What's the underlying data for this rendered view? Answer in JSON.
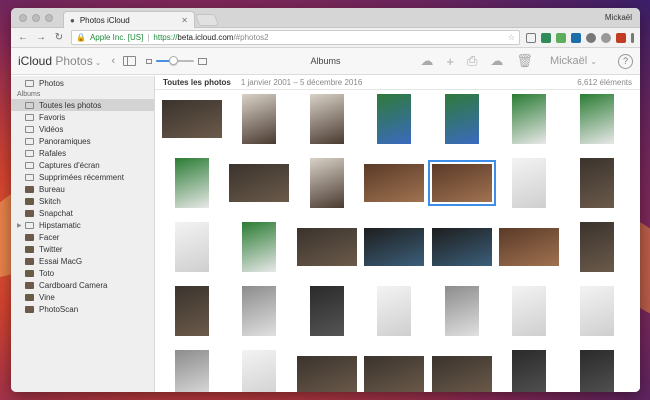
{
  "browser": {
    "tab_title": "Photos iCloud",
    "profile_name": "Mickaël",
    "security_label": "Apple Inc. [US]",
    "url_scheme": "https://",
    "url_host": "beta.icloud.com",
    "url_path": "/#photos2"
  },
  "app": {
    "brand": "iCloud",
    "app_name": "Photos",
    "view_title": "Albums",
    "account_name": "Mickaël",
    "zoom_level": 0.45
  },
  "sidebar": {
    "top_items": [
      {
        "label": "Photos",
        "icon": "photos-icon"
      }
    ],
    "section_label": "Albums",
    "album_items": [
      {
        "label": "Toutes les photos",
        "icon": "all-photos-icon",
        "selected": true
      },
      {
        "label": "Favoris",
        "icon": "heart-icon"
      },
      {
        "label": "Vidéos",
        "icon": "video-icon"
      },
      {
        "label": "Panoramiques",
        "icon": "panorama-icon"
      },
      {
        "label": "Rafales",
        "icon": "burst-icon"
      },
      {
        "label": "Captures d'écran",
        "icon": "screenshot-icon"
      },
      {
        "label": "Supprimées récemment",
        "icon": "trash-icon"
      },
      {
        "label": "Bureau",
        "icon": "album-thumb-icon"
      },
      {
        "label": "Skitch",
        "icon": "album-thumb-icon"
      },
      {
        "label": "Snapchat",
        "icon": "album-thumb-icon"
      },
      {
        "label": "Hipstamatic",
        "icon": "folder-icon",
        "disclosure": true
      },
      {
        "label": "Facer",
        "icon": "album-thumb-icon"
      },
      {
        "label": "Twitter",
        "icon": "album-thumb-icon"
      },
      {
        "label": "Essai MacG",
        "icon": "album-thumb-icon"
      },
      {
        "label": "Toto",
        "icon": "album-thumb-icon"
      },
      {
        "label": "Cardboard Camera",
        "icon": "album-thumb-icon"
      },
      {
        "label": "Vine",
        "icon": "album-thumb-icon"
      },
      {
        "label": "PhotoScan",
        "icon": "album-thumb-icon"
      }
    ]
  },
  "content": {
    "title": "Toutes les photos",
    "date_range": "1 janvier 2001 – 5 décembre 2016",
    "count": "6,612 éléments"
  },
  "photos": [
    {
      "orient": "landscape",
      "kind": "cat"
    },
    {
      "orient": "portrait",
      "kind": "selfie"
    },
    {
      "orient": "portrait",
      "kind": "selfie"
    },
    {
      "orient": "portrait",
      "kind": "game-green"
    },
    {
      "orient": "portrait",
      "kind": "game-green"
    },
    {
      "orient": "portrait",
      "kind": "solitaire"
    },
    {
      "orient": "portrait",
      "kind": "solitaire"
    },
    {
      "orient": "portrait",
      "kind": "solitaire"
    },
    {
      "orient": "landscape",
      "kind": "cat"
    },
    {
      "orient": "portrait",
      "kind": "selfie"
    },
    {
      "orient": "landscape",
      "kind": "cat-floor"
    },
    {
      "orient": "landscape",
      "kind": "cat-floor",
      "selected": true
    },
    {
      "orient": "portrait",
      "kind": "screen-white"
    },
    {
      "orient": "portrait",
      "kind": "cat"
    },
    {
      "orient": "portrait",
      "kind": "screen-white"
    },
    {
      "orient": "portrait",
      "kind": "solitaire"
    },
    {
      "orient": "landscape",
      "kind": "cat"
    },
    {
      "orient": "landscape",
      "kind": "dark-screen"
    },
    {
      "orient": "landscape",
      "kind": "dark-screen"
    },
    {
      "orient": "landscape",
      "kind": "cat-floor"
    },
    {
      "orient": "portrait",
      "kind": "cat"
    },
    {
      "orient": "portrait",
      "kind": "cat"
    },
    {
      "orient": "portrait",
      "kind": "screen-gray"
    },
    {
      "orient": "portrait",
      "kind": "screen-dark"
    },
    {
      "orient": "portrait",
      "kind": "screen-white"
    },
    {
      "orient": "portrait",
      "kind": "screen-gray"
    },
    {
      "orient": "portrait",
      "kind": "screen-white"
    },
    {
      "orient": "portrait",
      "kind": "screen-white"
    },
    {
      "orient": "portrait",
      "kind": "screen-gray"
    },
    {
      "orient": "portrait",
      "kind": "screen-white"
    },
    {
      "orient": "landscape",
      "kind": "cat"
    },
    {
      "orient": "landscape",
      "kind": "cat"
    },
    {
      "orient": "landscape",
      "kind": "cat"
    },
    {
      "orient": "portrait",
      "kind": "screen-dark"
    },
    {
      "orient": "portrait",
      "kind": "screen-dark"
    }
  ],
  "colors": {
    "accent": "#3d8ee8",
    "secure": "#1c8a3a",
    "sidebar_bg": "#efefef",
    "selected_row": "#d3d3d3"
  }
}
